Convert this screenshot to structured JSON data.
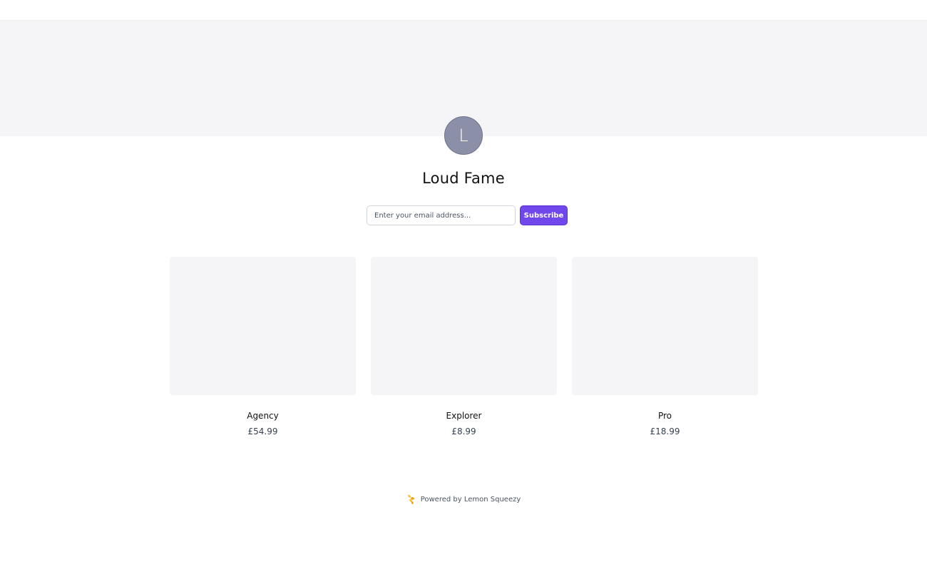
{
  "store": {
    "avatar_initial": "L",
    "name": "Loud Fame"
  },
  "subscribe": {
    "placeholder": "Enter your email address...",
    "button_label": "Subscribe"
  },
  "products": [
    {
      "name": "Agency",
      "price": "£54.99"
    },
    {
      "name": "Explorer",
      "price": "£8.99"
    },
    {
      "name": "Pro",
      "price": "£18.99"
    }
  ],
  "footer": {
    "powered_by": "Powered by Lemon Squeezy",
    "icon": "lemon-squeezy-logo-icon"
  },
  "colors": {
    "accent": "#7047eb",
    "avatar_bg": "#8b90a8",
    "banner_bg": "#f5f5f7",
    "lemon": "#fbbf24"
  }
}
